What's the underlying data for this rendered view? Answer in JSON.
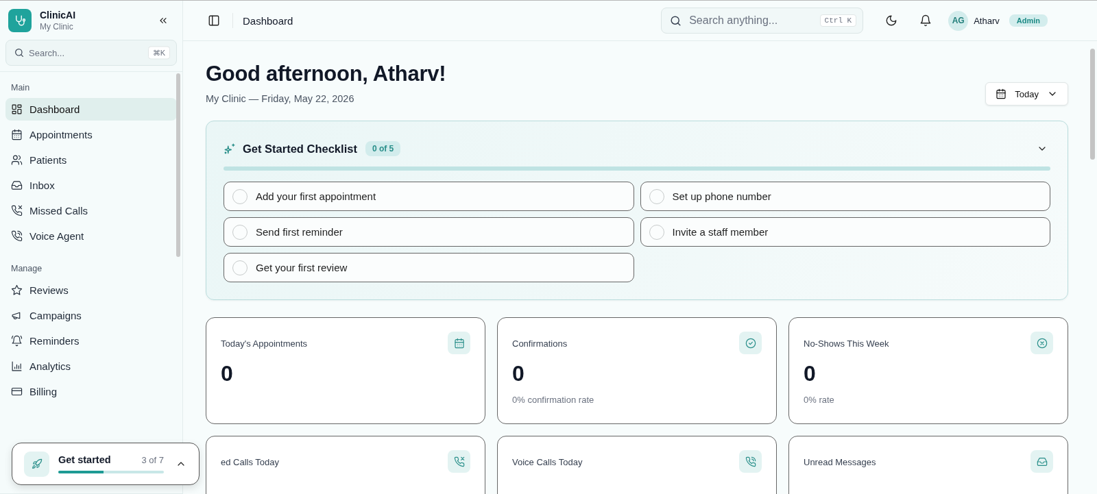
{
  "sidebar": {
    "brand": {
      "name": "ClinicAI",
      "subtitle": "My Clinic"
    },
    "search": {
      "placeholder": "Search...",
      "shortcut": "⌘K"
    },
    "sections": [
      {
        "title": "Main",
        "items": [
          {
            "label": "Dashboard",
            "selected": true
          },
          {
            "label": "Appointments",
            "selected": false
          },
          {
            "label": "Patients",
            "selected": false
          },
          {
            "label": "Inbox",
            "selected": false
          },
          {
            "label": "Missed Calls",
            "selected": false
          },
          {
            "label": "Voice Agent",
            "selected": false
          }
        ]
      },
      {
        "title": "Manage",
        "items": [
          {
            "label": "Reviews",
            "selected": false
          },
          {
            "label": "Campaigns",
            "selected": false
          },
          {
            "label": "Reminders",
            "selected": false
          },
          {
            "label": "Analytics",
            "selected": false
          },
          {
            "label": "Billing",
            "selected": false
          }
        ]
      }
    ]
  },
  "header": {
    "breadcrumb": "Dashboard",
    "search": {
      "placeholder": "Search anything...",
      "shortcut": "Ctrl K"
    },
    "user": {
      "initials": "AG",
      "name": "Atharv",
      "role": "Admin"
    }
  },
  "greeting": {
    "title": "Good afternoon, Atharv!",
    "subtitle": "My Clinic — Friday, May 22, 2026"
  },
  "date_filter": "Today",
  "checklist": {
    "title": "Get Started Checklist",
    "count": "0 of 5",
    "expanded": true,
    "level": 0,
    "items": [
      {
        "label": "Add your first appointment",
        "checked": false
      },
      {
        "label": "Set up phone number",
        "checked": false
      },
      {
        "label": "Send first reminder",
        "checked": false
      },
      {
        "label": "Invite a staff member",
        "checked": false
      },
      {
        "label": "Get your first review",
        "checked": false
      }
    ]
  },
  "stats": [
    {
      "label": "Today's Appointments",
      "value": "0"
    },
    {
      "label": "Confirmations",
      "value": "0",
      "note": "0% confirmation rate"
    },
    {
      "label": "No-Shows This Week",
      "value": "0",
      "note": "0% rate"
    },
    {
      "label": "ed Calls Today"
    },
    {
      "label": "Voice Calls Today"
    },
    {
      "label": "Unread Messages"
    }
  ],
  "get_started_popup": {
    "title": "Get started",
    "count": "3 of 7",
    "level": 0.43,
    "expanded": false
  }
}
